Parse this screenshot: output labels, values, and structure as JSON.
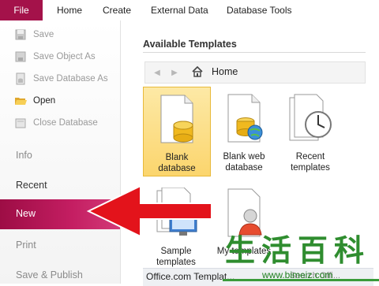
{
  "ribbon": {
    "file_tab": "File",
    "tabs": [
      "Home",
      "Create",
      "External Data",
      "Database Tools"
    ]
  },
  "sidebar": {
    "commands": [
      {
        "label": "Save",
        "icon": "save-icon",
        "enabled": false
      },
      {
        "label": "Save Object As",
        "icon": "save-object-as-icon",
        "enabled": false
      },
      {
        "label": "Save Database As",
        "icon": "save-database-as-icon",
        "enabled": false
      },
      {
        "label": "Open",
        "icon": "open-folder-icon",
        "enabled": true
      },
      {
        "label": "Close Database",
        "icon": "close-database-icon",
        "enabled": false
      }
    ],
    "nav": {
      "info": "Info",
      "recent": "Recent",
      "new": "New",
      "print": "Print",
      "save_publish": "Save & Publish"
    }
  },
  "main": {
    "section_title": "Available Templates",
    "breadcrumb": {
      "back_icon": "back-arrow-icon",
      "forward_icon": "forward-arrow-icon",
      "home_icon": "home-icon",
      "label": "Home"
    },
    "templates": [
      {
        "line1": "Blank",
        "line2": "database",
        "selected": true
      },
      {
        "line1": "Blank web",
        "line2": "database",
        "selected": false
      },
      {
        "line1": "Recent",
        "line2": "templates",
        "selected": false
      },
      {
        "line1": "Sample",
        "line2": "templates",
        "selected": false
      },
      {
        "line1": "My templates",
        "line2": "",
        "selected": false
      }
    ],
    "office_section": "Office.com Templat...",
    "search_hint": "Search Offi..."
  },
  "watermark": {
    "chars": [
      "生",
      "活",
      "百",
      "科"
    ],
    "url": "www.bimeiz.com"
  },
  "colors": {
    "file_tab": "#a4124a",
    "nav_new": "#c41e62",
    "selected_tile": "#fbd56d",
    "arrow": "#e3131b",
    "watermark": "#2f8d2f"
  }
}
